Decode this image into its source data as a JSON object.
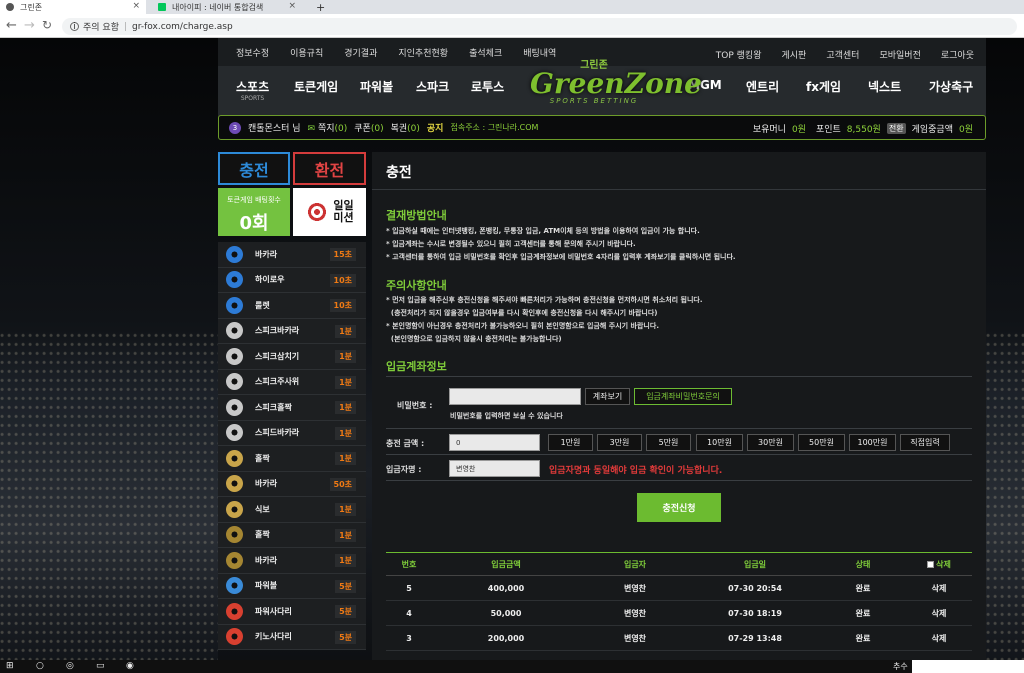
{
  "browser": {
    "tabs": [
      {
        "label": "그린존",
        "close": "×",
        "fav_color": "#555555"
      },
      {
        "label": "내아이피 : 네이버 통합검색",
        "close": "×",
        "fav_color": "#03c75a"
      }
    ],
    "new_tab": "+",
    "security_label": "주의 요함",
    "url": "gr-fox.com/charge.asp"
  },
  "topnav": {
    "left": [
      "정보수정",
      "이용규칙",
      "경기결과",
      "지인추천현황",
      "출석체크",
      "배팅내역"
    ],
    "right": [
      "TOP 랭킹왕",
      "게시판",
      "고객센터",
      "모바일버전",
      "로그아웃"
    ]
  },
  "logo": {
    "kr": "그린존",
    "en": "GreenZone",
    "sub": "SPORTS BETTING"
  },
  "mainmenu": [
    {
      "label": "스포츠",
      "sub": "SPORTS"
    },
    {
      "label": "토큰게임",
      "sub": ""
    },
    {
      "label": "파워볼",
      "sub": ""
    },
    {
      "label": "스파크",
      "sub": ""
    },
    {
      "label": "로투스",
      "sub": ""
    },
    {
      "label": "MGM",
      "sub": ""
    },
    {
      "label": "엔트리",
      "sub": ""
    },
    {
      "label": "fx게임",
      "sub": ""
    },
    {
      "label": "넥스트",
      "sub": ""
    },
    {
      "label": "가상축구",
      "sub": ""
    }
  ],
  "infobar": {
    "level_icon": "3",
    "username": "캔톨몬스터 님",
    "notes_label": "쪽지",
    "notes_count": "(0)",
    "coupon_label": "쿠폰",
    "coupon_count": "(0)",
    "lottery_label": "복권",
    "lottery_count": "(0)",
    "notice_label": "공지",
    "notice_text": "접속주소 : 그린나라.COM",
    "money_label": "보유머니",
    "money_value": "0원",
    "point_label": "포인트",
    "point_value": "8,550원",
    "convert_label": "전환",
    "game_label": "게임중금액",
    "game_value": "0원"
  },
  "sidebar": {
    "charge_label": "충전",
    "exchange_label": "환전",
    "bet_count_label": "토큰게임 배팅횟수",
    "bet_count_value": "0회",
    "mission_label_1": "일일",
    "mission_label_2": "미션",
    "games": [
      {
        "name": "바카라",
        "time": "15초",
        "icon_color": "#2d7bd6"
      },
      {
        "name": "하이로우",
        "time": "10초",
        "icon_color": "#2d7bd6"
      },
      {
        "name": "룰렛",
        "time": "10초",
        "icon_color": "#2d7bd6"
      },
      {
        "name": "스피크바카라",
        "time": "1분",
        "icon_color": "#c8c8c8"
      },
      {
        "name": "스피크삼치기",
        "time": "1분",
        "icon_color": "#c8c8c8"
      },
      {
        "name": "스피크주사위",
        "time": "1분",
        "icon_color": "#c8c8c8"
      },
      {
        "name": "스피크홀짝",
        "time": "1분",
        "icon_color": "#c8c8c8"
      },
      {
        "name": "스피드바카라",
        "time": "1분",
        "icon_color": "#c8c8c8"
      },
      {
        "name": "홀짝",
        "time": "1분",
        "icon_color": "#c9a54a"
      },
      {
        "name": "바카라",
        "time": "50초",
        "icon_color": "#c9a54a"
      },
      {
        "name": "식보",
        "time": "1분",
        "icon_color": "#c9a54a"
      },
      {
        "name": "홀짝",
        "time": "1분",
        "icon_color": "#a58632"
      },
      {
        "name": "바카라",
        "time": "1분",
        "icon_color": "#a58632"
      },
      {
        "name": "파워볼",
        "time": "5분",
        "icon_color": "#3a8bd8"
      },
      {
        "name": "파워사다리",
        "time": "5분",
        "icon_color": "#d84030"
      },
      {
        "name": "키노사다리",
        "time": "5분",
        "icon_color": "#d84030"
      }
    ]
  },
  "main": {
    "title": "충전",
    "payment_title": "결재방법안내",
    "payment_notes": [
      "* 입금하실 때에는 인터넷뱅킹, 폰뱅킹, 무통장 입금, ATM이체 등의 방법을 이용하여 입금이 가능 합니다.",
      "* 입금계좌는 수시로 변경될수 있으니 필히 고객센터를 통해 문의해 주시기 바랍니다.",
      "* 고객센터를 통하여 입금 비밀번호를 확인후 입금계좌정보에 비밀번호 4자리를 입력후 계좌보기를 클릭하시면 됩니다."
    ],
    "caution_title": "주의사항안내",
    "caution_notes": [
      "* 먼저 입금을 해주신후 충전신청을 해주셔야 빠른처리가 가능하며 충전신청을 먼저하시면 취소처리 됩니다.",
      "  (충전처리가 되지 않을경우 입금여부를 다시 확인후에 충전신청을 다시 해주시기 바랍니다)",
      "* 본인명함이 아닌경우 충전처리가 불가능하오니 필히 본인명함으로 입금해 주시기 바랍니다.",
      "  (본인명함으로 입금하지 않을시 충전처리는 불가능합니다)"
    ],
    "account_title": "입금계좌정보",
    "password_label": "비밀번호 :",
    "password_value": "",
    "view_account_btn": "계좌보기",
    "inquiry_btn": "입금계좌비밀번호문의",
    "password_hint": "비밀번호를 입력하면 보실 수 있습니다",
    "amount_label": "충전 금액 :",
    "amount_value": "0",
    "amount_buttons": [
      "1만원",
      "3만원",
      "5만원",
      "10만원",
      "30만원",
      "50만원",
      "100만원",
      "직접입력"
    ],
    "depositor_label": "입금자명 :",
    "depositor_value": "변영찬",
    "depositor_warning": "입금자명과 동일해야 입금 확인이 가능합니다.",
    "submit_label": "충전신청",
    "table_headers": [
      "번호",
      "입금금액",
      "입금자",
      "입금일",
      "상태",
      "삭제"
    ],
    "rows": [
      {
        "no": "5",
        "amount": "400,000",
        "name": "변영찬",
        "date": "07-30 20:54",
        "status": "완료",
        "del": "삭제"
      },
      {
        "no": "4",
        "amount": "50,000",
        "name": "변영찬",
        "date": "07-30 18:19",
        "status": "완료",
        "del": "삭제"
      },
      {
        "no": "3",
        "amount": "200,000",
        "name": "변영찬",
        "date": "07-29 13:48",
        "status": "완료",
        "del": "삭제"
      }
    ]
  },
  "taskbar": {
    "time_label": "추수"
  }
}
